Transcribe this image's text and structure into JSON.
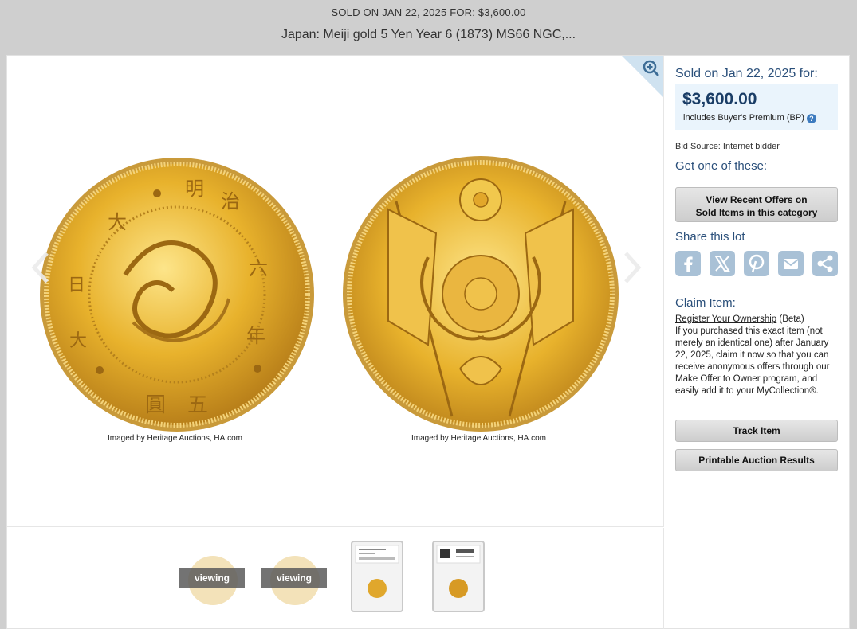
{
  "header": {
    "sold_line": "SOLD ON JAN 22, 2025 FOR: $3,600.00",
    "title": "Japan: Meiji gold 5 Yen Year 6 (1873) MS66 NGC,..."
  },
  "viewer": {
    "credit_left": "Imaged by Heritage Auctions, HA.com",
    "credit_right": "Imaged by Heritage Auctions, HA.com"
  },
  "thumbs": [
    {
      "label": "viewing"
    },
    {
      "label": "viewing"
    }
  ],
  "sidebar": {
    "sold_on": "Sold on Jan 22, 2025 for:",
    "price": "$3,600.00",
    "bp": "includes Buyer's Premium (BP)",
    "help": "?",
    "bid_source": "Bid Source: Internet bidder",
    "get_one": "Get one of these:",
    "offers_btn_line1": "View Recent Offers on",
    "offers_btn_line2": "Sold Items in this category",
    "share_label": "Share this lot",
    "claim_label": "Claim Item:",
    "register_link": "Register Your Ownership",
    "register_beta": " (Beta)",
    "claim_body": "If you purchased this exact item (not merely an identical one) after January 22, 2025, claim it now so that you can receive anonymous offers through our Make Offer to Owner program, and easily add it to your MyCollection®.",
    "track_btn": "Track Item",
    "print_btn": "Printable Auction Results"
  },
  "colors": {
    "accent_blue": "#2a4f7a",
    "price_box": "#eaf4fc",
    "share_icon": "#a9c1d6",
    "gold": "#e8b22c"
  },
  "icons": [
    "zoom-in-icon",
    "chevron-left-icon",
    "chevron-right-icon",
    "facebook-icon",
    "x-icon",
    "pinterest-icon",
    "email-icon",
    "share-icon",
    "help-icon"
  ]
}
